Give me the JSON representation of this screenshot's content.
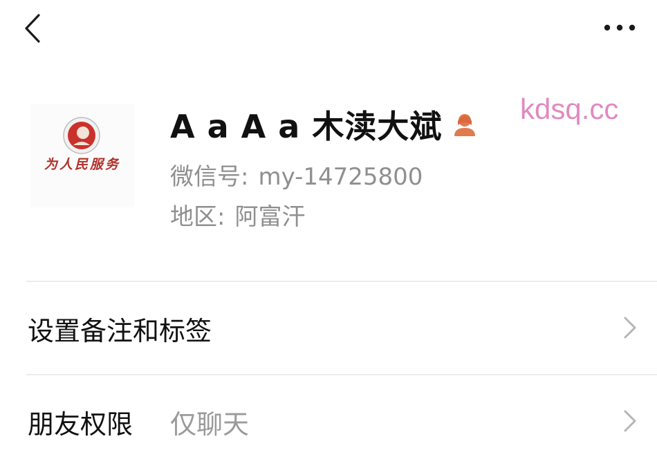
{
  "topbar": {
    "back_icon": "chevron-left-icon",
    "more_icon": "more-dots-icon"
  },
  "profile": {
    "avatar_icon": "avatar-image",
    "avatar_text": "为人民服务",
    "name": "A a A a 木渎大斌",
    "gender_icon": "female-user-icon",
    "gender_color": "#e07a4f",
    "wechat_id_label": "微信号:",
    "wechat_id": "my-14725800",
    "region_label": "地区:",
    "region": "阿富汗"
  },
  "watermark": "kdsq.cc",
  "menu": [
    {
      "label": "设置备注和标签",
      "value": "",
      "icon": "chevron-right-icon"
    },
    {
      "label": "朋友权限",
      "value": "仅聊天",
      "icon": "chevron-right-icon"
    }
  ]
}
